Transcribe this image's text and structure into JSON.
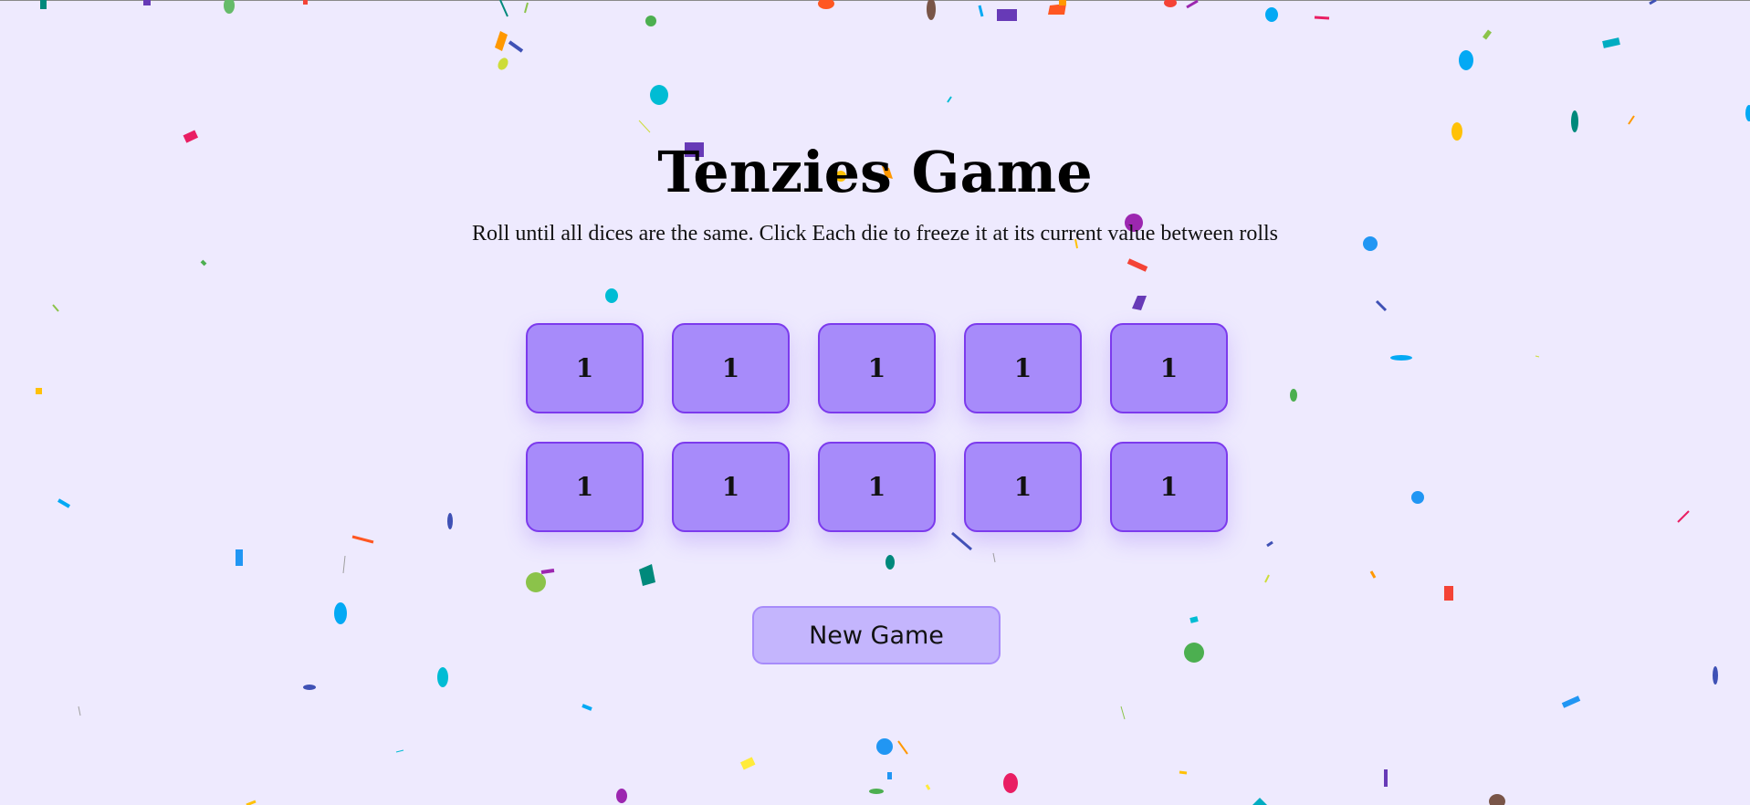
{
  "title": "Tenzies Game",
  "instructions": "Roll until all dices are the same. Click Each die to freeze it at its current value between rolls",
  "dice": [
    "1",
    "1",
    "1",
    "1",
    "1",
    "1",
    "1",
    "1",
    "1",
    "1"
  ],
  "new_game_label": "New Game",
  "colors": {
    "background": "#eeeafe",
    "die_fill": "#a78bfa",
    "die_border": "#7c3aed",
    "button_fill": "#c4b5fd"
  }
}
